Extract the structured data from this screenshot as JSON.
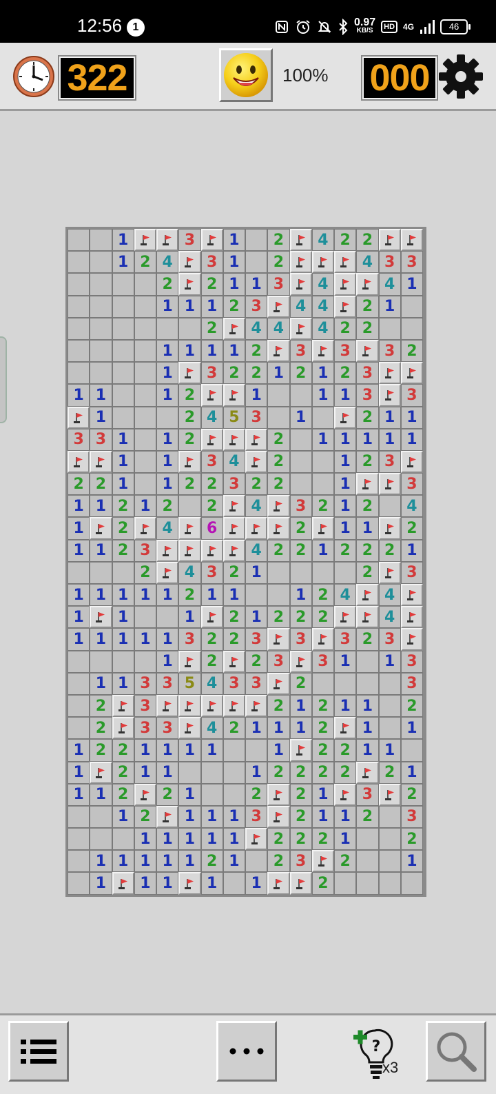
{
  "status_bar": {
    "time": "12:56",
    "notification_count": "1",
    "net_speed_value": "0.97",
    "net_speed_unit": "KB/S",
    "hd_label": "HD",
    "network_label": "4G",
    "battery": "46",
    "icons": [
      "nfc-icon",
      "alarm-icon",
      "mute-icon",
      "bluetooth-icon",
      "signal-icon"
    ]
  },
  "header": {
    "timer_value": "322",
    "mine_counter_value": "000",
    "zoom_label": "100%",
    "icons": {
      "clock": "clock-icon",
      "smiley": "smiley-face-icon",
      "settings": "gear-icon"
    }
  },
  "board": {
    "columns": 16,
    "rows": 30,
    "legend": "' ' = unrevealed empty, 'F' = flagged, digit = adjacent mine count",
    "cells": [
      "  1FF3F1 2F422FF",
      "  124F31 2FFF433",
      "    2F2113F4FF41",
      "    11123F44F21",
      "      2F44F422 ",
      "    11112F3F3F32",
      "    1F32212123FF",
      "11  12FF1  113F3",
      "F1   2453 1 F211",
      "331 12FFF2 11111",
      "FF1 1F34F2  123F",
      "221 122322  1FF3",
      "11212 2F4F3212 4F",
      "1F2F4F6FFF2F11F2",
      "1123FFFF42212221",
      "   2F4321    2F31",
      "11111211  124F4F",
      "1F1  1F21222FF4F3",
      "111113223F3F323F3",
      "    1F2F23F31 13F",
      " 11335433F2    3F",
      " 2F3FFFFF21211 2F",
      " 2F33F421112F1 11",
      "1221111  1F2211 ",
      "1F211   12222F21",
      "112F21  2F21F3F2",
      "  12F1113F2112 3F",
      "   11111F2221  2F",
      " 1111121 23F2  11",
      " 1F11F1 1FF2    "
    ]
  }
}
